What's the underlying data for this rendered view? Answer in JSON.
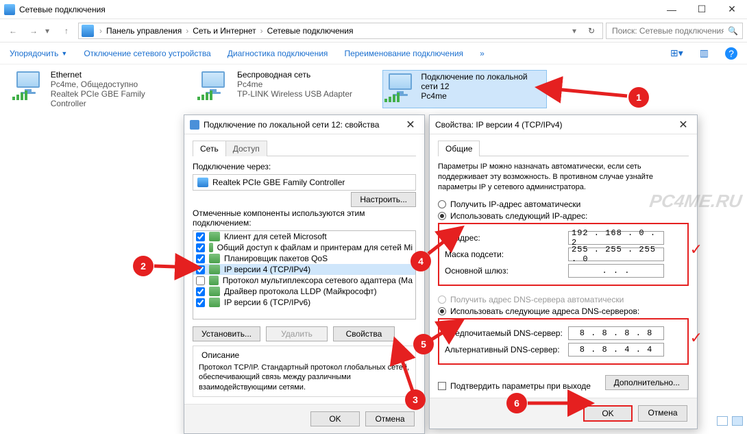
{
  "window": {
    "title": "Сетевые подключения",
    "min": "—",
    "max": "☐",
    "close": "✕"
  },
  "nav": {
    "back": "←",
    "fwd": "→",
    "drop": "▾",
    "up": "↑",
    "crumbs": [
      "Панель управления",
      "Сеть и Интернет",
      "Сетевые подключения"
    ],
    "refresh": "↻",
    "search_placeholder": "Поиск: Сетевые подключения"
  },
  "toolbar": {
    "organize": "Упорядочить",
    "disable": "Отключение сетевого устройства",
    "diagnose": "Диагностика подключения",
    "rename": "Переименование подключения",
    "view": "⊞",
    "help": "?"
  },
  "connections": [
    {
      "name": "Ethernet",
      "l2": "Pc4me, Общедоступно",
      "l3": "Realtek PCIe GBE Family Controller"
    },
    {
      "name": "Беспроводная сеть",
      "l2": "Pc4me",
      "l3": "TP-LINK Wireless USB Adapter"
    },
    {
      "name": "Подключение по локальной сети 12",
      "l2": "Pc4me",
      "l3": ""
    }
  ],
  "dlg1": {
    "title": "Подключение по локальной сети 12: свойства",
    "tab_net": "Сеть",
    "tab_access": "Доступ",
    "connect_via": "Подключение через:",
    "adapter": "Realtek PCIe GBE Family Controller",
    "configure": "Настроить...",
    "components_label": "Отмеченные компоненты используются этим подключением:",
    "items": [
      {
        "c": true,
        "t": "Клиент для сетей Microsoft"
      },
      {
        "c": true,
        "t": "Общий доступ к файлам и принтерам для сетей Mi"
      },
      {
        "c": true,
        "t": "Планировщик пакетов QoS"
      },
      {
        "c": true,
        "t": "IP версии 4 (TCP/IPv4)"
      },
      {
        "c": false,
        "t": "Протокол мультиплексора сетевого адаптера (Ма"
      },
      {
        "c": true,
        "t": "Драйвер протокола LLDP (Майкрософт)"
      },
      {
        "c": true,
        "t": "IP версии 6 (TCP/IPv6)"
      }
    ],
    "install": "Установить...",
    "remove": "Удалить",
    "props": "Свойства",
    "desc_title": "Описание",
    "desc": "Протокол TCP/IP. Стандартный протокол глобальных сетей, обеспечивающий связь между различными взаимодействующими сетями.",
    "ok": "OK",
    "cancel": "Отмена"
  },
  "dlg2": {
    "title": "Свойства: IP версии 4 (TCP/IPv4)",
    "tab": "Общие",
    "intro": "Параметры IP можно назначать автоматически, если сеть поддерживает эту возможность. В противном случае узнайте параметры IP у сетевого администратора.",
    "r_auto": "Получить IP-адрес автоматически",
    "r_manual": "Использовать следующий IP-адрес:",
    "ip_l": "IP-адрес:",
    "ip_v": "192 . 168 .  0  .  2",
    "mask_l": "Маска подсети:",
    "mask_v": "255 . 255 . 255 .  0",
    "gw_l": "Основной шлюз:",
    "gw_v": ".       .       .",
    "r_dns_auto": "Получить адрес DNS-сервера автоматически",
    "r_dns_manual": "Использовать следующие адреса DNS-серверов:",
    "dns1_l": "Предпочитаемый DNS-сервер:",
    "dns1_v": "8  .  8  .  8  .  8",
    "dns2_l": "Альтернативный DNS-сервер:",
    "dns2_v": "8  .  8  .  4  .  4",
    "confirm": "Подтвердить параметры при выходе",
    "advanced": "Дополнительно...",
    "ok": "OK",
    "cancel": "Отмена"
  },
  "watermark": "PC4ME.RU",
  "annotations": {
    "1": "1",
    "2": "2",
    "3": "3",
    "4": "4",
    "5": "5",
    "6": "6"
  }
}
